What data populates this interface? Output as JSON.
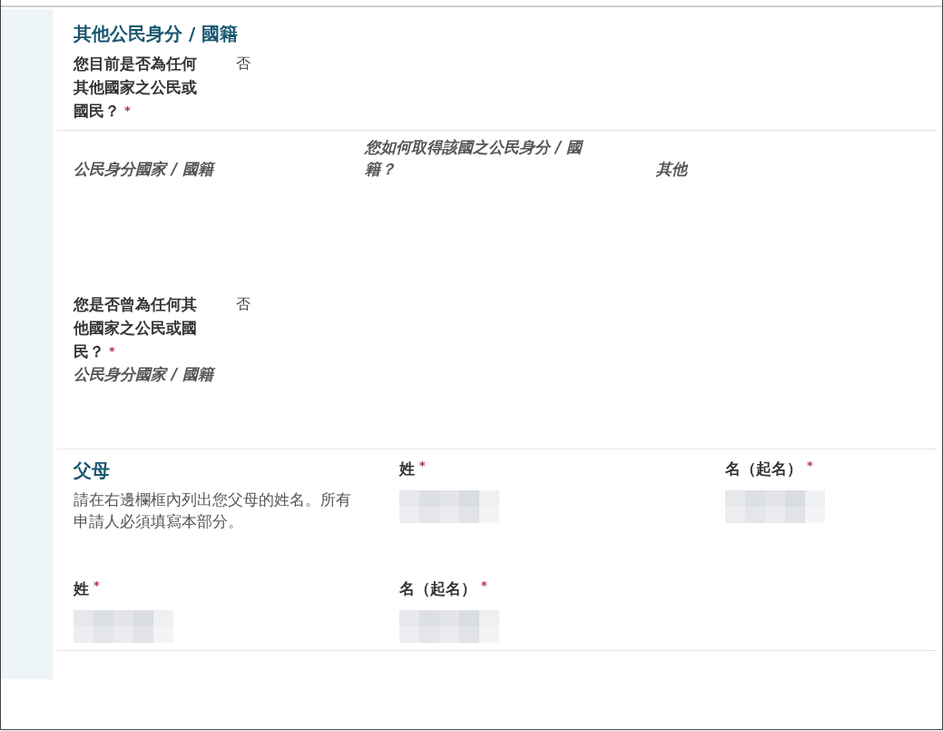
{
  "other_citizenship": {
    "title": "其他公民身分 / 國籍",
    "current_question": {
      "label": "您目前是否為任何其他國家之公民或國民？",
      "required_mark": "*",
      "value": "否"
    },
    "table": {
      "columns": [
        "公民身分國家 / 國籍",
        "您如何取得該國之公民身分 / 國籍？",
        "其他"
      ]
    },
    "former_question": {
      "label": "您是否曾為任何其他國家之公民或國民？",
      "required_mark": "*",
      "value": "否",
      "sub_label": "公民身分國家 / 國籍"
    }
  },
  "parents": {
    "title": "父母",
    "description": "請在右邊欄框內列出您父母的姓名。所有申請人必須填寫本部分。",
    "entries": [
      {
        "fields": [
          {
            "label": "姓",
            "required_mark": "*"
          },
          {
            "label": "名（起名）",
            "required_mark": "*"
          }
        ]
      },
      {
        "fields": [
          {
            "label": "姓",
            "required_mark": "*"
          },
          {
            "label": "名（起名）",
            "required_mark": "*"
          }
        ]
      }
    ]
  }
}
